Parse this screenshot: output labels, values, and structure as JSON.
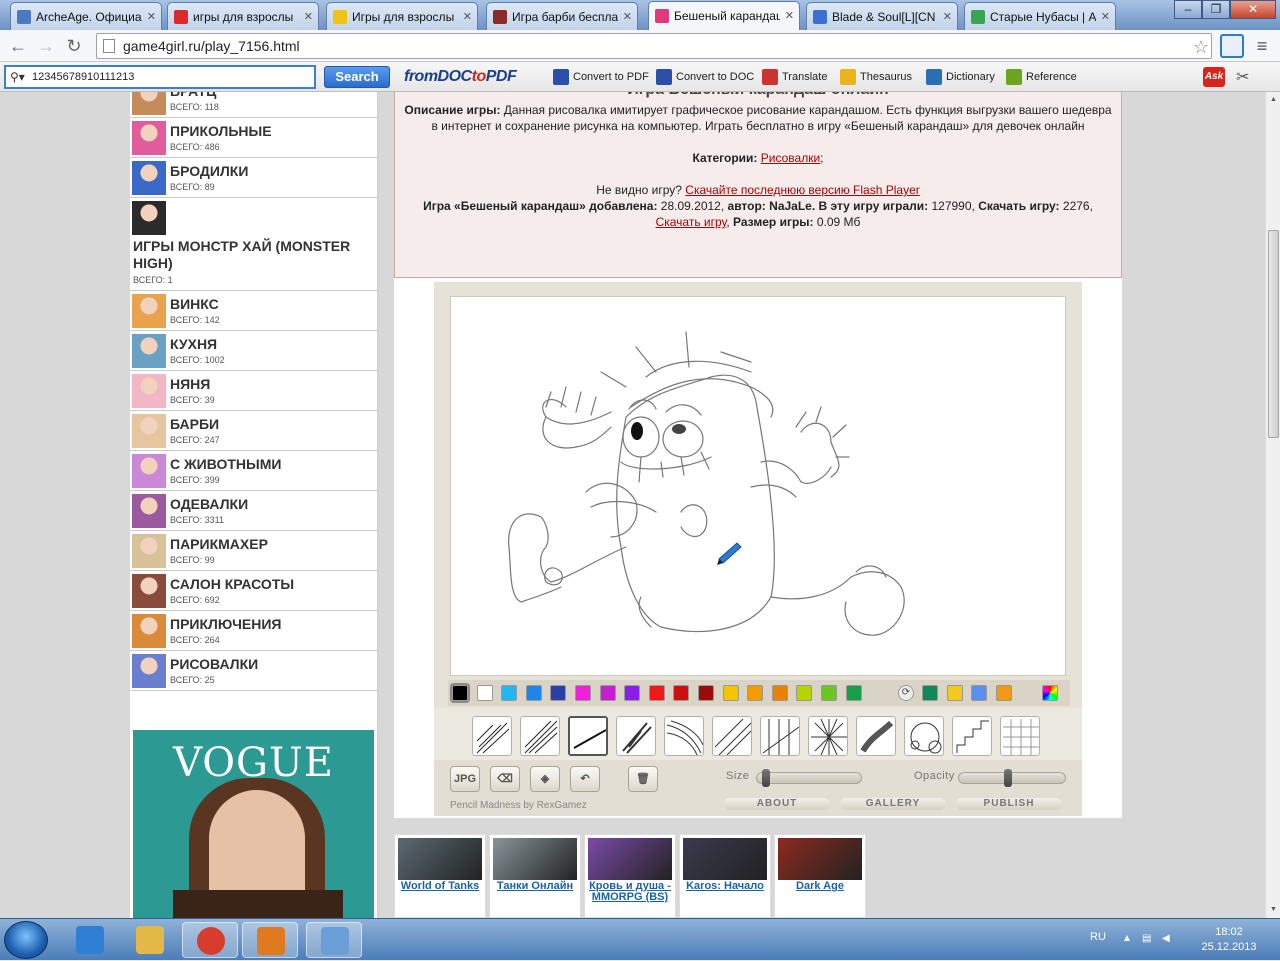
{
  "browser": {
    "tabs": [
      {
        "label": "ArcheAge. Официа",
        "color": "#4a7ac4"
      },
      {
        "label": "игры для взрослы",
        "color": "#d92b2b"
      },
      {
        "label": "Игры для взрослы",
        "color": "#f0c417"
      },
      {
        "label": "Игра барби беспла",
        "color": "#8a2a2a"
      },
      {
        "label": "Бешеный карандаш",
        "color": "#e03a7a"
      },
      {
        "label": "Blade & Soul[L][CN",
        "color": "#3b6fd0"
      },
      {
        "label": "Старые Нубасы | A",
        "color": "#3aa356"
      }
    ],
    "url": "game4girl.ru/play_7156.html"
  },
  "askbar": {
    "search_value": "12345678910111213",
    "search_button": "Search",
    "fromdoc_part1": "fromDOC",
    "fromdoc_part2": "to",
    "fromdoc_part3": "PDF",
    "items": [
      {
        "label": "Convert to PDF",
        "icon": "pdf-icon",
        "color": "#2b4fa8"
      },
      {
        "label": "Convert to DOC",
        "icon": "doc-icon",
        "color": "#2b4fa8"
      },
      {
        "label": "Translate",
        "icon": "translate-icon",
        "color": "#c33"
      },
      {
        "label": "Thesaurus",
        "icon": "thesaurus-icon",
        "color": "#e8b61c"
      },
      {
        "label": "Dictionary",
        "icon": "dictionary-icon",
        "color": "#2a6fb5"
      },
      {
        "label": "Reference",
        "icon": "reference-icon",
        "color": "#6aa51f"
      }
    ],
    "ask_badge": "Ask"
  },
  "sidebar": {
    "categories": [
      {
        "name": "БРАТЦ",
        "count": "ВСЕГО: 118",
        "color": "#c58b5a"
      },
      {
        "name": "ПРИКОЛЬНЫЕ",
        "count": "ВСЕГО: 486",
        "color": "#e05c9a"
      },
      {
        "name": "БРОДИЛКИ",
        "count": "ВСЕГО: 89",
        "color": "#3b69c7"
      },
      {
        "name": "ИГРЫ МОНСТР ХАЙ (MONSTER HIGH)",
        "count": "ВСЕГО: 1",
        "color": "#2b2b2b",
        "tall": true
      },
      {
        "name": "ВИНКС",
        "count": "ВСЕГО: 142",
        "color": "#e8a34c"
      },
      {
        "name": "КУХНЯ",
        "count": "ВСЕГО: 1002",
        "color": "#6aa0c2"
      },
      {
        "name": "НЯНЯ",
        "count": "ВСЕГО: 39",
        "color": "#f2b6c7"
      },
      {
        "name": "БАРБИ",
        "count": "ВСЕГО: 247",
        "color": "#e6c6a1"
      },
      {
        "name": "С ЖИВОТНЫМИ",
        "count": "ВСЕГО: 399",
        "color": "#c989d6"
      },
      {
        "name": "ОДЕВАЛКИ",
        "count": "ВСЕГО: 3311",
        "color": "#9c5a9e"
      },
      {
        "name": "ПАРИКМАХЕР",
        "count": "ВСЕГО: 99",
        "color": "#d8c29a"
      },
      {
        "name": "САЛОН КРАСОТЫ",
        "count": "ВСЕГО: 692",
        "color": "#8a4b3a"
      },
      {
        "name": "ПРИКЛЮЧЕНИЯ",
        "count": "ВСЕГО: 264",
        "color": "#d98a3a"
      },
      {
        "name": "РИСОВАЛКИ",
        "count": "ВСЕГО: 25",
        "color": "#6a7fd0"
      }
    ],
    "ad_text": "VOGUE"
  },
  "game": {
    "title": "Игра Бешеный карандаш онлайн",
    "desc_label": "Описание игры:",
    "desc_text": "Данная рисовалка имитирует графическое рисование карандашом. Есть функция выгрузки вашего шедевра в интернет и сохранение рисунка на компьютер. Играть бесплатно в игру «Бешеный карандаш» для девочек онлайн",
    "cat_label": "Категории:",
    "cat_link": "Рисовалки",
    "cat_tail": ";",
    "flash_text": "Не видно игру?",
    "flash_link": "Скачайте последнюю версию Flash Player",
    "added_label": "Игра «Бешеный карандаш» добавлена:",
    "added_date": "28.09.2012,",
    "author_label": "автор:",
    "author": "NaJaLe.",
    "played_label": "В эту игру играли:",
    "played": "127990,",
    "download_label": "Скачать игру:",
    "downloads": "2276,",
    "download_link": "Скачать игру",
    "size_label": "Размер игры:",
    "size": "0.09 Мб"
  },
  "paint": {
    "colors": [
      "#000000",
      "#ffffff",
      "#1fb8f0",
      "#1f86e8",
      "#2a40a6",
      "#f020d8",
      "#c81ed2",
      "#8a1ee8",
      "#f01818",
      "#cc1010",
      "#9c0a0a",
      "#f5c300",
      "#f59b00",
      "#e88200",
      "#b6d400",
      "#6ac620",
      "#18a048"
    ],
    "colors2": [
      "#11875a",
      "#f2c91f",
      "#5b8ff0",
      "#f29a13"
    ],
    "btn_jpg": "JPG",
    "size_label": "Size",
    "opacity_label": "Opacity",
    "size_value": 0.05,
    "opacity_value": 0.45,
    "about": "ABOUT",
    "gallery": "GALLERY",
    "publish": "PUBLISH",
    "credit": "Pencil Madness by RexGamez"
  },
  "related": [
    {
      "name": "World of Tanks",
      "color": "#5b6a73"
    },
    {
      "name": "Танки Онлайн",
      "color": "#88949a"
    },
    {
      "name": "Кровь и душа - MMORPG (BS)",
      "color": "#7b4aa8"
    },
    {
      "name": "Karos: Начало",
      "color": "#3a3a4e"
    },
    {
      "name": "Dark Age",
      "color": "#8e2a1e"
    }
  ],
  "taskbar": {
    "apps": [
      {
        "icon": "ie-icon",
        "color": "#2f7fd6"
      },
      {
        "icon": "explorer-icon",
        "color": "#e2b846"
      },
      {
        "icon": "chrome-icon",
        "color": "#d83c2c"
      },
      {
        "icon": "media-icon",
        "color": "#e07a1e"
      },
      {
        "icon": "paint-icon",
        "color": "#6a9fd8"
      }
    ],
    "lang": "RU",
    "time": "18:02",
    "date": "25.12.2013"
  }
}
